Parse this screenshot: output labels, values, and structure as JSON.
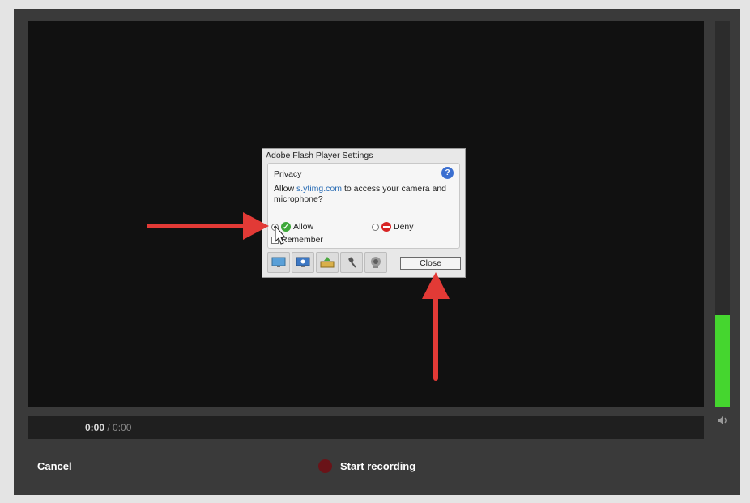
{
  "player": {
    "time_current": "0:00",
    "time_separator": " / ",
    "time_total": "0:00",
    "audio_level": 0.24,
    "meter_color": "#45d62f",
    "cancel_label": "Cancel",
    "record_label": "Start recording",
    "record_color": "#6a1318",
    "volume_icon": "speaker-icon"
  },
  "flash_dialog": {
    "title": "Adobe Flash Player Settings",
    "section": "Privacy",
    "message_prefix": "Allow ",
    "message_domain": "s.ytimg.com",
    "message_suffix": " to access your camera and microphone?",
    "allow_label": "Allow",
    "deny_label": "Deny",
    "remember_label": "Remember",
    "close_label": "Close",
    "allow_selected": true,
    "tabs": [
      "display-icon",
      "privacy-icon",
      "storage-icon",
      "microphone-icon",
      "camera-icon"
    ]
  },
  "annotation_color": "#e23a36"
}
